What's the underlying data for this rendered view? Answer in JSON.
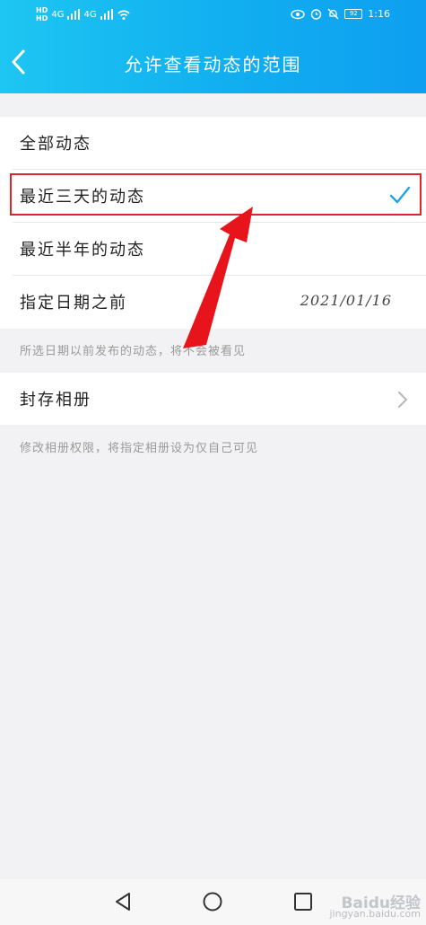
{
  "status_bar": {
    "hd1": "HD",
    "hd2": "HD",
    "net1": "4G",
    "net2": "4G",
    "time": "1:16",
    "battery": "92"
  },
  "header": {
    "title": "允许查看动态的范围"
  },
  "options": [
    {
      "label": "全部动态",
      "selected": false
    },
    {
      "label": "最近三天的动态",
      "selected": true
    },
    {
      "label": "最近半年的动态",
      "selected": false
    },
    {
      "label": "指定日期之前",
      "value": "2021/01/16",
      "selected": false
    }
  ],
  "notes": {
    "range_note": "所选日期以前发布的动态，将不会被看见",
    "album_note": "修改相册权限，将指定相册设为仅自己可见"
  },
  "album": {
    "label": "封存相册"
  },
  "watermark": {
    "brand": "Baidu经验",
    "url": "jingyan.baidu.com"
  },
  "colors": {
    "header_start": "#1ec6f2",
    "header_end": "#0e9ff0",
    "check": "#1aa6e8",
    "highlight": "#e0252a",
    "arrow": "#e8141b"
  }
}
